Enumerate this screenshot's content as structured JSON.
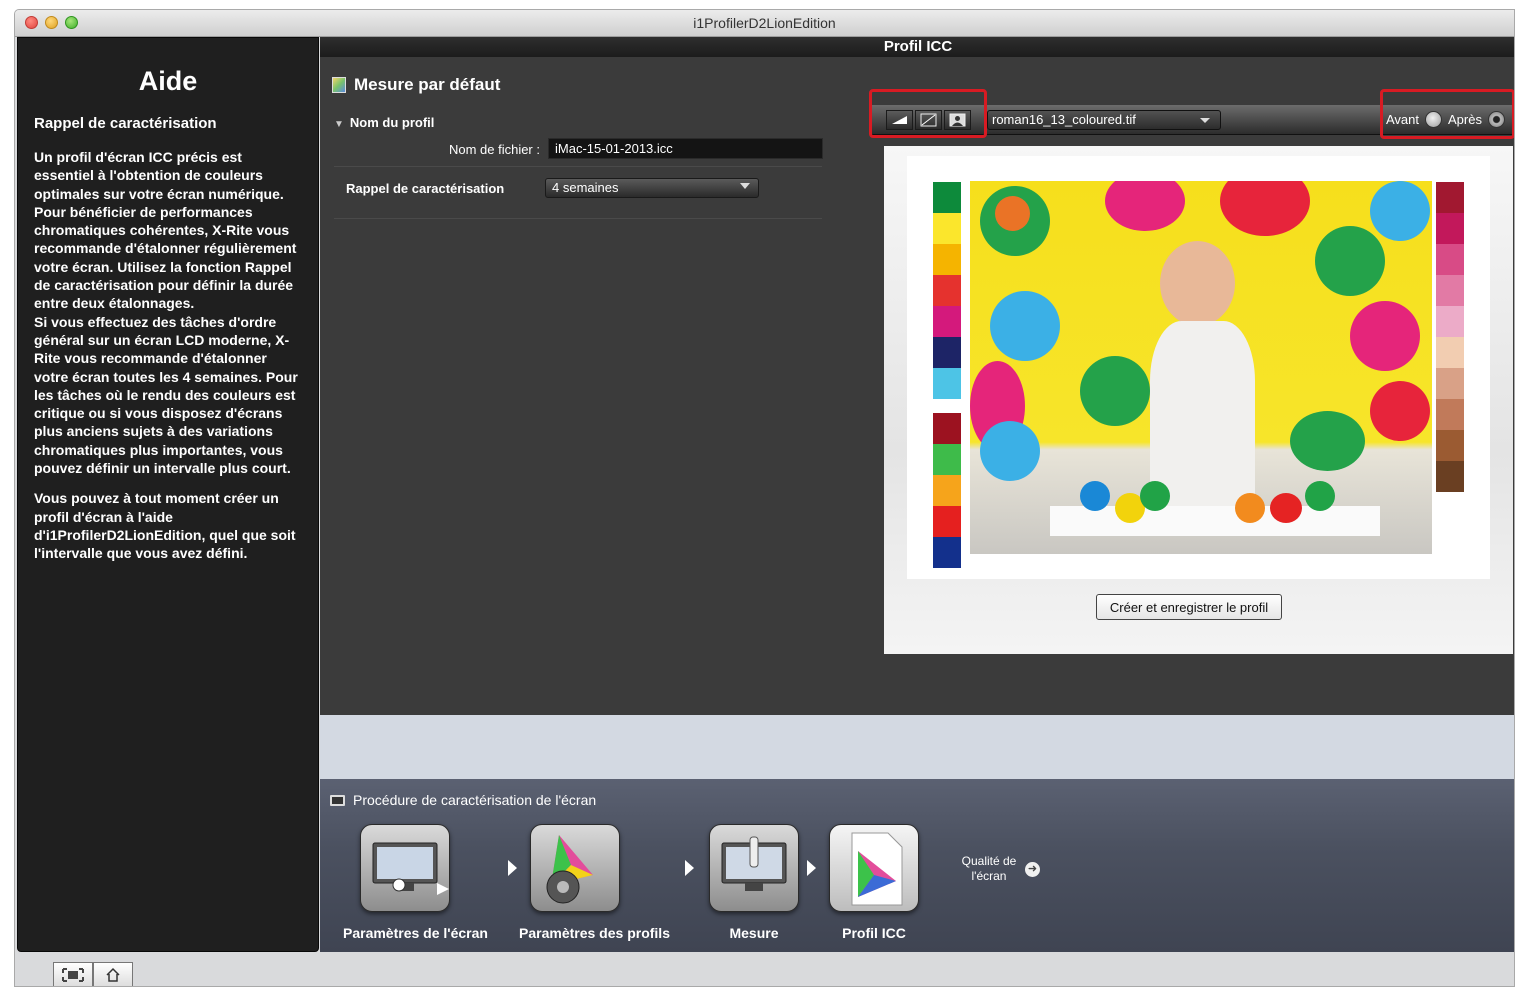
{
  "window": {
    "title": "i1ProfilerD2LionEdition"
  },
  "help": {
    "title": "Aide",
    "subtitle": "Rappel de caractérisation",
    "para1": "Un profil d'écran ICC précis est essentiel à l'obtention de couleurs optimales sur votre écran numérique. Pour bénéficier de performances chromatiques cohérentes, X-Rite vous recommande d'étalonner régulièrement votre écran. Utilisez la fonction Rappel de caractérisation pour définir la durée entre deux étalonnages.",
    "para2": "Si vous effectuez des tâches d'ordre général sur un écran LCD moderne, X-Rite vous recommande d'étalonner votre écran toutes les 4 semaines. Pour les tâches où le rendu des couleurs est critique ou si vous disposez d'écrans plus anciens sujets à des variations chromatiques plus importantes, vous pouvez définir un intervalle plus court.",
    "para3": "Vous pouvez à tout moment créer un profil d'écran à l'aide d'i1ProfilerD2LionEdition, quel que soit l'intervalle que vous avez défini."
  },
  "main": {
    "title": "Profil ICC",
    "section": "Mesure par défaut",
    "profile_name_header": "Nom du profil",
    "file_label": "Nom de fichier :",
    "file_value": "iMac-15-01-2013.icc",
    "reminder_label": "Rappel de caractérisation",
    "reminder_value": "4 semaines"
  },
  "preview": {
    "image_file": "roman16_13_coloured.tif",
    "before": "Avant",
    "after": "Après",
    "create_button": "Créer et enregistrer le profil",
    "swatches_left": [
      "#0d8a3b",
      "#fbe62c",
      "#f5b400",
      "#e5322e",
      "#d4197c",
      "#1d2466",
      "#4dc4e6",
      "#9c1220",
      "#3ebb4a",
      "#f6a41b",
      "#e5201f",
      "#13308c"
    ],
    "swatches_right": [
      "#a11830",
      "#c2185b",
      "#d84b86",
      "#e27aa5",
      "#ecabc8",
      "#f2cdb1",
      "#d9a187",
      "#c17a5a",
      "#9b5b32",
      "#6a3f22"
    ]
  },
  "workflow": {
    "title": "Procédure de caractérisation de l'écran",
    "steps": [
      "Paramètres de l'écran",
      "Paramètres des profils",
      "Mesure",
      "Profil ICC"
    ],
    "quality": "Qualité de l'écran"
  }
}
